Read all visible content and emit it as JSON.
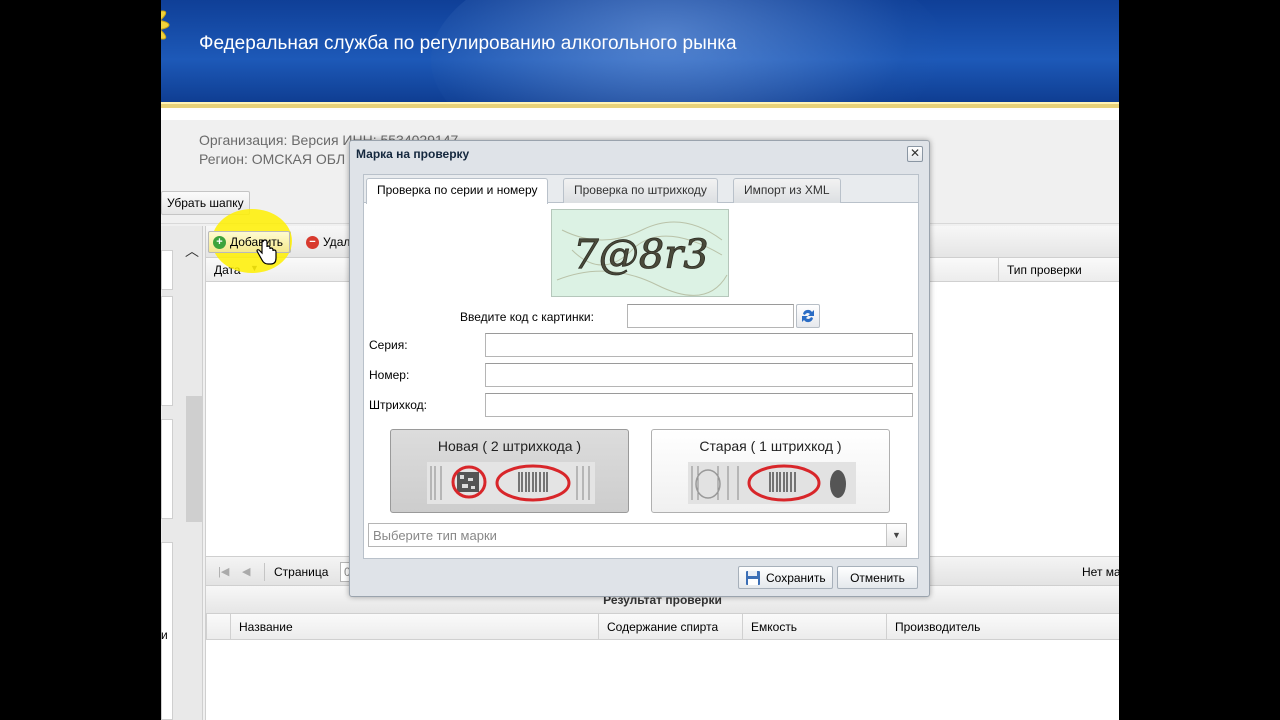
{
  "header": {
    "title": "Федеральная служба по регулированию алкогольного рынка"
  },
  "org_info": {
    "organization": "Организация: Версия  ИНН: 5534029147",
    "region": "Регион: ОМСКАЯ ОБЛ"
  },
  "toolbar": {
    "hide_header_label": "Убрать шапку"
  },
  "grid": {
    "add_label": "Добавить",
    "delete_label": "Удал",
    "columns": {
      "date": "Дата",
      "check_type": "Тип проверки"
    },
    "pager": {
      "page_label": "Страница",
      "page_value": "0",
      "no_data": "Нет ма"
    }
  },
  "result": {
    "title": "Результат проверки",
    "columns": [
      "Название",
      "Содержание спирта",
      "Емкость",
      "Производитель"
    ]
  },
  "left_panel": {
    "label": "и"
  },
  "modal": {
    "title": "Марка на проверку",
    "tabs": [
      "Проверка по серии и номеру",
      "Проверка по штрихкоду",
      "Импорт из XML"
    ],
    "captcha_text": "7@8r3",
    "captcha_label": "Введите код с картинки:",
    "series_label": "Серия:",
    "number_label": "Номер:",
    "barcode_label": "Штрихкод:",
    "mark_new_label": "Новая ( 2 штрихкода )",
    "mark_old_label": "Старая ( 1 штрихкод )",
    "mark_type_placeholder": "Выберите тип марки",
    "save_label": "Сохранить",
    "cancel_label": "Отменить"
  },
  "colors": {
    "banner": "#1d59b8",
    "highlight": "#fff000",
    "mark_circle": "#d8262a"
  }
}
